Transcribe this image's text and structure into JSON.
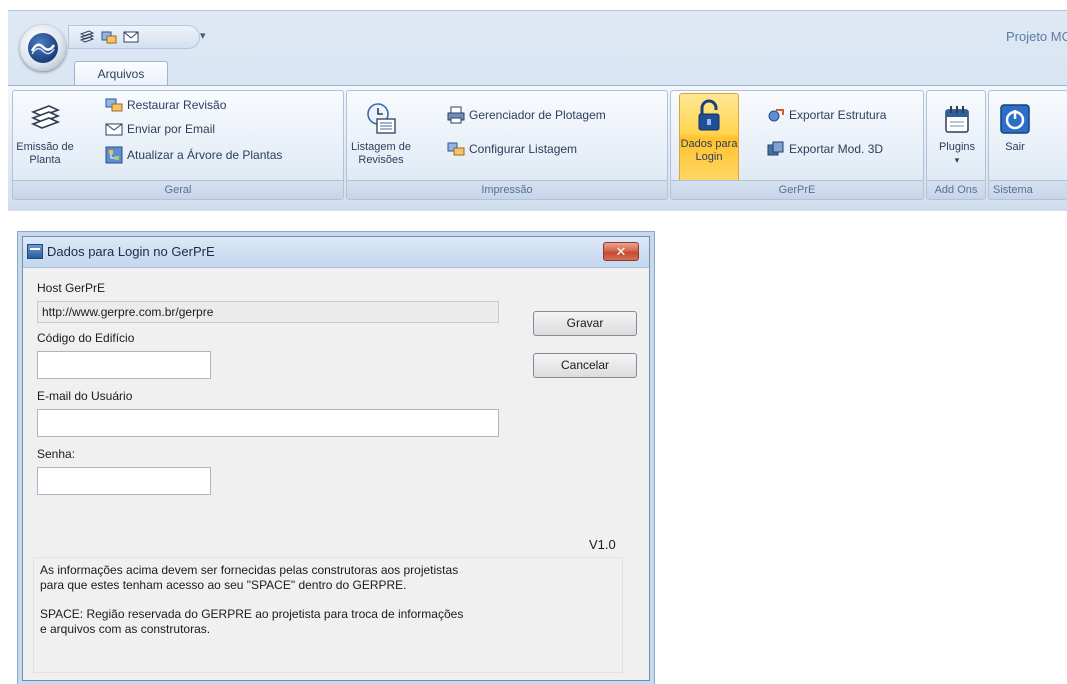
{
  "window": {
    "title": "Projeto MC"
  },
  "ribbon": {
    "tab_label": "Arquivos",
    "qat_dropdown": "▾",
    "groups": {
      "geral": {
        "label": "Geral",
        "emissao": "Emissão de Planta",
        "restaurar": "Restaurar Revisão",
        "enviar": "Enviar por Email",
        "atualizar": "Atualizar a Árvore de Plantas"
      },
      "impressao": {
        "label": "Impressão",
        "listagem": "Listagem de Revisões",
        "gerenciador": "Gerenciador de Plotagem",
        "configurar": "Configurar Listagem"
      },
      "gerpre": {
        "label": "GerPrE",
        "dados": "Dados para Login",
        "exportar_estrutura": "Exportar Estrutura",
        "exportar_mod3d": "Exportar Mod. 3D"
      },
      "addons": {
        "label": "Add Ons",
        "plugins": "Plugins",
        "plugins_arrow": "▾"
      },
      "sistema": {
        "label": "Sistema",
        "sair": "Sair"
      }
    }
  },
  "dialog": {
    "title": "Dados para Login no GerPrE",
    "close": "✕",
    "host_label": "Host GerPrE",
    "host_value": "http://www.gerpre.com.br/gerpre",
    "codigo_label": "Código do Edifício",
    "codigo_value": "",
    "email_label": "E-mail do Usuário",
    "email_value": "",
    "senha_label": "Senha:",
    "senha_value": "",
    "gravar": "Gravar",
    "cancelar": "Cancelar",
    "version": "V1.0",
    "info_1": "As informações acima devem ser fornecidas pelas construtoras aos projetistas\npara que estes tenham acesso ao seu \"SPACE\" dentro do GERPRE.",
    "info_2": "SPACE: Região reservada do GERPRE ao projetista para troca de informações\ne arquivos com as construtoras."
  }
}
